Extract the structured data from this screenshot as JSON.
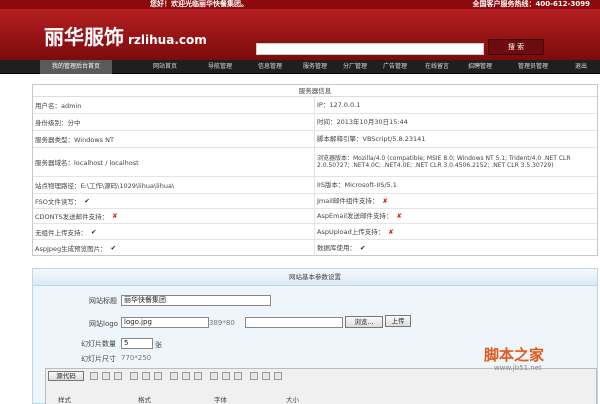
{
  "topbar": {
    "welcome": "您好！欢迎光临丽华快餐集团。",
    "hotline": "全国客户服务热线：400-612-3099"
  },
  "header": {
    "logo_text": "丽华服饰",
    "logo_domain": "rzlihua.com",
    "search_button": "搜 索"
  },
  "nav": {
    "items": [
      "我的管理后台首页",
      "网站首页",
      "导航管理",
      "信息管理",
      "服务管理",
      "分厂管理",
      "广告管理",
      "在线留言",
      "招聘管理",
      "管理员管理",
      "退出"
    ],
    "active": 0
  },
  "server_info": {
    "title": "服务器信息",
    "rows": [
      {
        "left": "用户名：admin",
        "right": "IP：127.0.0.1"
      },
      {
        "left": "身份级别：分中",
        "right": "时间：2013年10月30日15:44"
      },
      {
        "left": "服务器类型：Windows NT",
        "right": "脚本解释引擎：VBScript/5.8.23141"
      },
      {
        "left": "服务器域名：localhost / localhost",
        "right": "浏览器版本：Mozilla/4.0 (compatible; MSIE 8.0; Windows NT 5.1; Trident/4.0 .NET CLR 2.0.50727; .NET4.0C; .NET4.0E; .NET CLR 3.0.4506.2152; .NET CLR 3.5.30729)"
      },
      {
        "left": "站点物理路径：E:\\工作\\源码\\1029\\lihua\\lihua\\",
        "right": "IIS版本：Microsoft-IIS/5.1"
      },
      {
        "left": "FSO文件读写：",
        "left_mark": "✔",
        "right": "Jmail邮件组件支持：",
        "right_mark": "✘"
      },
      {
        "left": "CDONTS发送邮件支持：",
        "left_mark": "✘",
        "right": "AspEmail发送邮件支持：",
        "right_mark": "✘"
      },
      {
        "left": "无组件上传支持：",
        "left_mark": "✔",
        "right": "AspUpload上传支持：",
        "right_mark": "✘"
      },
      {
        "left": "AspJpeg生成预览图片：",
        "left_mark": "✔",
        "right": "数据库使用：",
        "right_mark": "✔"
      }
    ]
  },
  "form": {
    "title": "网站基本参数设置",
    "site_title_label": "网站标题",
    "site_title_value": "丽华快餐集团",
    "logo_label": "网站logo",
    "logo_value": "logo.jpg",
    "logo_size": "389*80",
    "browse_button": "浏览...",
    "upload_button": "上传",
    "count_label": "幻灯片数量",
    "count_value": "5",
    "count_unit": "张",
    "size_label": "幻灯片尺寸",
    "size_value": "770*250",
    "toolbar_source": "源代码",
    "toolbar_style": "样式",
    "toolbar_format": "格式",
    "toolbar_font": "字体",
    "toolbar_size": "大小"
  },
  "watermark": {
    "text": "脚本之家",
    "site": "www.jb51.net"
  }
}
